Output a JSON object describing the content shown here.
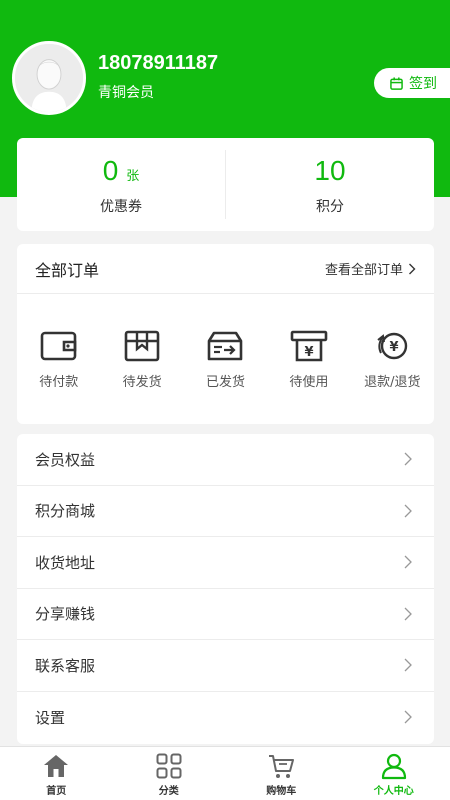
{
  "colors": {
    "brand": "#10b90f"
  },
  "profile": {
    "phone": "18078911187",
    "level": "青铜会员",
    "checkin_label": "签到"
  },
  "stats": [
    {
      "value": "0",
      "unit": "张",
      "label": "优惠券"
    },
    {
      "value": "10",
      "unit": "",
      "label": "积分"
    }
  ],
  "orders": {
    "title": "全部订单",
    "view_all": "查看全部订单",
    "items": [
      {
        "label": "待付款",
        "icon": "wallet-icon"
      },
      {
        "label": "待发货",
        "icon": "package-icon"
      },
      {
        "label": "已发货",
        "icon": "shipped-icon"
      },
      {
        "label": "待使用",
        "icon": "ticket-yen-icon"
      },
      {
        "label": "退款/退货",
        "icon": "refund-yen-icon"
      }
    ]
  },
  "menu": [
    {
      "label": "会员权益"
    },
    {
      "label": "积分商城"
    },
    {
      "label": "收货地址"
    },
    {
      "label": "分享赚钱"
    },
    {
      "label": "联系客服"
    },
    {
      "label": "设置"
    }
  ],
  "tabs": [
    {
      "label": "首页",
      "icon": "home-icon"
    },
    {
      "label": "分类",
      "icon": "grid-icon"
    },
    {
      "label": "购物车",
      "icon": "cart-icon"
    },
    {
      "label": "个人中心",
      "icon": "user-icon",
      "active": true
    }
  ]
}
